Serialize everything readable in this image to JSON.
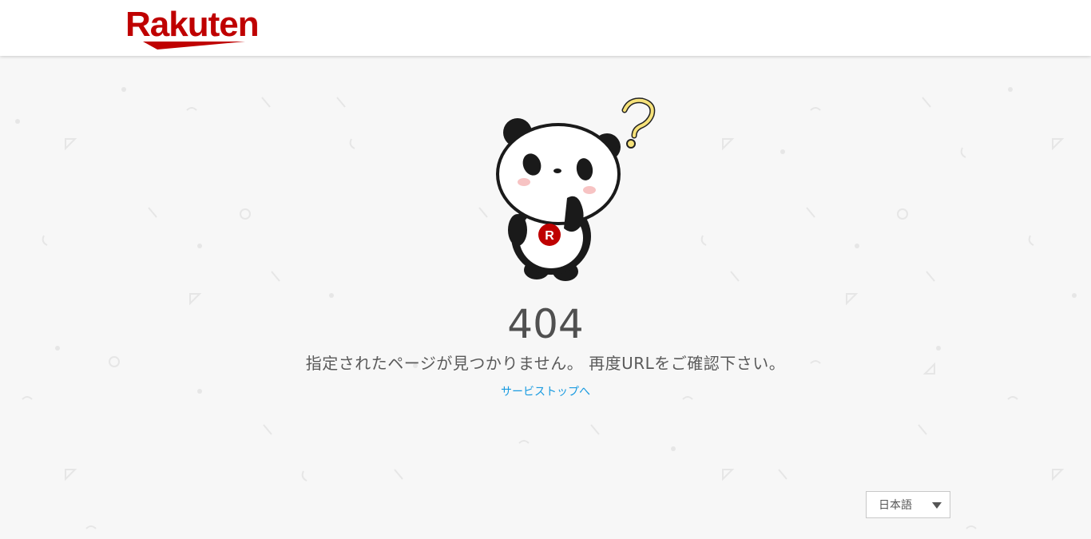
{
  "header": {
    "logo_text": "Rakuten"
  },
  "error": {
    "code": "404",
    "message": "指定されたページが見つかりません。 再度URLをご確認下さい。",
    "link_label": "サービストップへ",
    "mascot_badge": "R"
  },
  "footer": {
    "language_selected": "日本語"
  },
  "colors": {
    "brand": "#bf0000",
    "link": "#1a9be0",
    "background": "#f7f7f7"
  }
}
